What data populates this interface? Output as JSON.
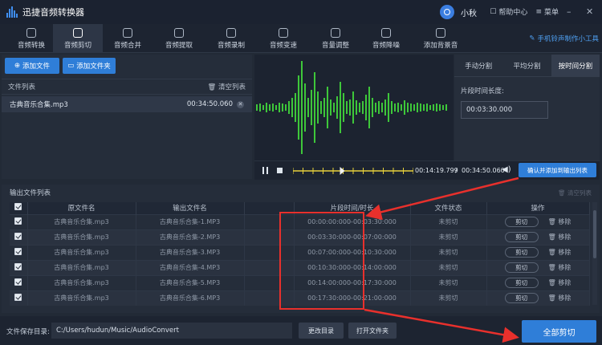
{
  "app": {
    "title": "迅捷音频转换器",
    "user": "小秋",
    "help": "帮助中心",
    "menu": "菜单"
  },
  "toolbar": {
    "items": [
      {
        "label": "音频转换"
      },
      {
        "label": "音频剪切"
      },
      {
        "label": "音频合并"
      },
      {
        "label": "音频提取"
      },
      {
        "label": "音频录制"
      },
      {
        "label": "音频变速"
      },
      {
        "label": "音量调整"
      },
      {
        "label": "音频降噪"
      },
      {
        "label": "添加背景音"
      }
    ],
    "active": 1,
    "mobile_tool": "手机铃声制作小工具"
  },
  "left": {
    "add_file": "添加文件",
    "add_folder": "添加文件夹",
    "list_title": "文件列表",
    "clear": "清空列表",
    "file": {
      "name": "古典音乐合集.mp3",
      "duration": "00:34:50.060"
    }
  },
  "right": {
    "tabs": [
      "手动分割",
      "平均分割",
      "按时间分割"
    ],
    "active_tab": 2,
    "segment_label": "片段时间长度:",
    "segment_value": "00:03:30.000"
  },
  "player": {
    "current": "00:14:19.799",
    "separator": "/",
    "total": "00:34:50.060",
    "confirm": "确认并添加到输出列表",
    "progress": 0.41
  },
  "output": {
    "title": "输出文件列表",
    "clear": "清空列表",
    "columns": [
      "原文件名",
      "输出文件名",
      "片段时间/时长",
      "文件状态",
      "操作"
    ],
    "cut_label": "剪切",
    "remove_label": "移除",
    "rows": [
      {
        "src": "古典音乐合集.mp3",
        "out": "古典音乐合集-1.MP3",
        "range": "00:00:00:000-00:03:30:000",
        "status": "未剪切"
      },
      {
        "src": "古典音乐合集.mp3",
        "out": "古典音乐合集-2.MP3",
        "range": "00:03:30:000-00:07:00:000",
        "status": "未剪切"
      },
      {
        "src": "古典音乐合集.mp3",
        "out": "古典音乐合集-3.MP3",
        "range": "00:07:00:000-00:10:30:000",
        "status": "未剪切"
      },
      {
        "src": "古典音乐合集.mp3",
        "out": "古典音乐合集-4.MP3",
        "range": "00:10:30:000-00:14:00:000",
        "status": "未剪切"
      },
      {
        "src": "古典音乐合集.mp3",
        "out": "古典音乐合集-5.MP3",
        "range": "00:14:00:000-00:17:30:000",
        "status": "未剪切"
      },
      {
        "src": "古典音乐合集.mp3",
        "out": "古典音乐合集-6.MP3",
        "range": "00:17:30:000-00:21:00:000",
        "status": "未剪切"
      }
    ]
  },
  "footer": {
    "save_label": "文件保存目录:",
    "save_path": "C:/Users/hudun/Music/AudioConvert",
    "change_dir": "更改目录",
    "open_folder": "打开文件夹",
    "cut_all": "全部剪切"
  },
  "colors": {
    "accent": "#2f7ed8",
    "wave": "#3ec73a",
    "annotation": "#e8302c"
  }
}
